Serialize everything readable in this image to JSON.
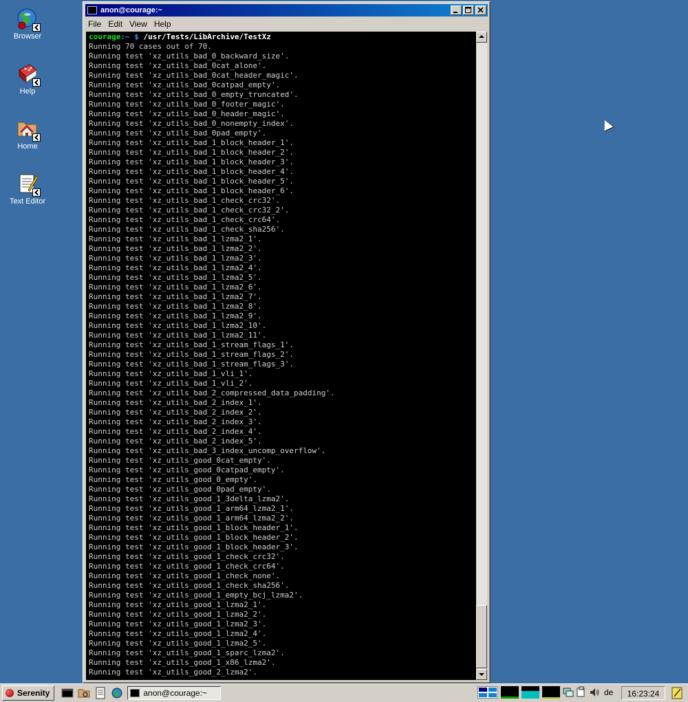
{
  "desktop": {
    "icons": [
      {
        "label": "Browser"
      },
      {
        "label": "Help"
      },
      {
        "label": "Home"
      },
      {
        "label": "Text Editor"
      }
    ]
  },
  "window": {
    "title": "anon@courage:~",
    "menu": [
      "File",
      "Edit",
      "View",
      "Help"
    ]
  },
  "terminal": {
    "prompt_user": "courage",
    "prompt_dir": ":~ $ ",
    "prompt_cmd": "/usr/Tests/LibArchive/TestXz",
    "lines": [
      "Running 70 cases out of 70.",
      "Running test 'xz_utils_bad_0_backward_size'.",
      "Running test 'xz_utils_bad_0cat_alone'.",
      "Running test 'xz_utils_bad_0cat_header_magic'.",
      "Running test 'xz_utils_bad_0catpad_empty'.",
      "Running test 'xz_utils_bad_0_empty_truncated'.",
      "Running test 'xz_utils_bad_0_footer_magic'.",
      "Running test 'xz_utils_bad_0_header_magic'.",
      "Running test 'xz_utils_bad_0_nonempty_index'.",
      "Running test 'xz_utils_bad_0pad_empty'.",
      "Running test 'xz_utils_bad_1_block_header_1'.",
      "Running test 'xz_utils_bad_1_block_header_2'.",
      "Running test 'xz_utils_bad_1_block_header_3'.",
      "Running test 'xz_utils_bad_1_block_header_4'.",
      "Running test 'xz_utils_bad_1_block_header_5'.",
      "Running test 'xz_utils_bad_1_block_header_6'.",
      "Running test 'xz_utils_bad_1_check_crc32'.",
      "Running test 'xz_utils_bad_1_check_crc32_2'.",
      "Running test 'xz_utils_bad_1_check_crc64'.",
      "Running test 'xz_utils_bad_1_check_sha256'.",
      "Running test 'xz_utils_bad_1_lzma2_1'.",
      "Running test 'xz_utils_bad_1_lzma2_2'.",
      "Running test 'xz_utils_bad_1_lzma2_3'.",
      "Running test 'xz_utils_bad_1_lzma2_4'.",
      "Running test 'xz_utils_bad_1_lzma2_5'.",
      "Running test 'xz_utils_bad_1_lzma2_6'.",
      "Running test 'xz_utils_bad_1_lzma2_7'.",
      "Running test 'xz_utils_bad_1_lzma2_8'.",
      "Running test 'xz_utils_bad_1_lzma2_9'.",
      "Running test 'xz_utils_bad_1_lzma2_10'.",
      "Running test 'xz_utils_bad_1_lzma2_11'.",
      "Running test 'xz_utils_bad_1_stream_flags_1'.",
      "Running test 'xz_utils_bad_1_stream_flags_2'.",
      "Running test 'xz_utils_bad_1_stream_flags_3'.",
      "Running test 'xz_utils_bad_1_vli_1'.",
      "Running test 'xz_utils_bad_1_vli_2'.",
      "Running test 'xz_utils_bad_2_compressed_data_padding'.",
      "Running test 'xz_utils_bad_2_index_1'.",
      "Running test 'xz_utils_bad_2_index_2'.",
      "Running test 'xz_utils_bad_2_index_3'.",
      "Running test 'xz_utils_bad_2_index_4'.",
      "Running test 'xz_utils_bad_2_index_5'.",
      "Running test 'xz_utils_bad_3_index_uncomp_overflow'.",
      "Running test 'xz_utils_good_0cat_empty'.",
      "Running test 'xz_utils_good_0catpad_empty'.",
      "Running test 'xz_utils_good_0_empty'.",
      "Running test 'xz_utils_good_0pad_empty'.",
      "Running test 'xz_utils_good_1_3delta_lzma2'.",
      "Running test 'xz_utils_good_1_arm64_lzma2_1'.",
      "Running test 'xz_utils_good_1_arm64_lzma2_2'.",
      "Running test 'xz_utils_good_1_block_header_1'.",
      "Running test 'xz_utils_good_1_block_header_2'.",
      "Running test 'xz_utils_good_1_block_header_3'.",
      "Running test 'xz_utils_good_1_check_crc32'.",
      "Running test 'xz_utils_good_1_check_crc64'.",
      "Running test 'xz_utils_good_1_check_none'.",
      "Running test 'xz_utils_good_1_check_sha256'.",
      "Running test 'xz_utils_good_1_empty_bcj_lzma2'.",
      "Running test 'xz_utils_good_1_lzma2_1'.",
      "Running test 'xz_utils_good_1_lzma2_2'.",
      "Running test 'xz_utils_good_1_lzma2_3'.",
      "Running test 'xz_utils_good_1_lzma2_4'.",
      "Running test 'xz_utils_good_1_lzma2_5'.",
      "Running test 'xz_utils_good_1_sparc_lzma2'.",
      "Running test 'xz_utils_good_1_x86_lzma2'.",
      "Running test 'xz_utils_good_2_lzma2'."
    ]
  },
  "taskbar": {
    "start_label": "Serenity",
    "task_label": "anon@courage:~",
    "keyboard_layout": "de",
    "clock": "16:23:24"
  },
  "colors": {
    "desktop": "#3b6ea5",
    "titlebar_start": "#000080",
    "titlebar_end": "#1084d0",
    "prompt_user": "#19e619",
    "prompt_dir": "#3b8eea"
  }
}
